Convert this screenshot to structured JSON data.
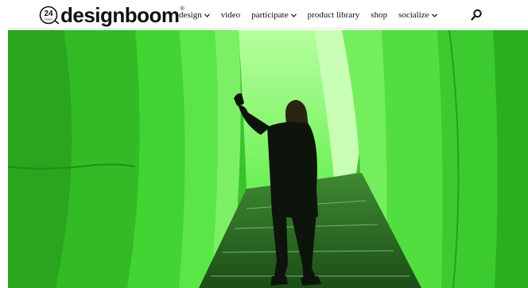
{
  "brand": {
    "name": "designboom",
    "badge_text": "24 hours",
    "registered_mark": "®"
  },
  "nav": [
    {
      "label": "design",
      "has_dropdown": true
    },
    {
      "label": "video",
      "has_dropdown": false
    },
    {
      "label": "participate",
      "has_dropdown": true
    },
    {
      "label": "product library",
      "has_dropdown": false
    },
    {
      "label": "shop",
      "has_dropdown": false
    },
    {
      "label": "socialize",
      "has_dropdown": true
    }
  ],
  "search_icon": "search-icon",
  "hero": {
    "image_colors": {
      "light": "#7ff76d",
      "mid": "#2fd61f",
      "dark": "#0b6e08"
    }
  }
}
